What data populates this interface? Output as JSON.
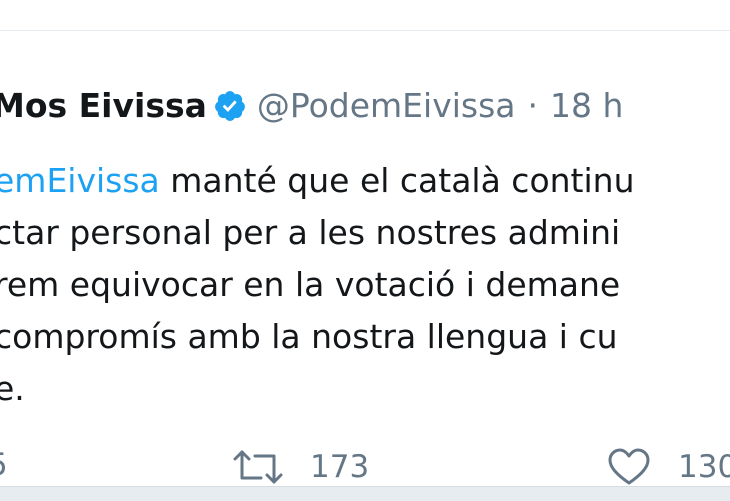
{
  "tweet": {
    "author_name": "Mos Eivissa",
    "verified": true,
    "handle": "@PodemEivissa",
    "separator": "·",
    "time": "18 h",
    "body_lines": [
      {
        "mention": "emEivissa",
        "text": " manté que el català continu"
      },
      {
        "mention": "",
        "text": "ctar personal per a les nostres admini"
      },
      {
        "mention": "",
        "text": "rem equivocar en la votació i demane"
      },
      {
        "mention": "",
        "text": "compromís amb la nostra llengua i cu"
      },
      {
        "mention": "",
        "text": "e."
      }
    ]
  },
  "actions": {
    "reply_count": "5",
    "retweet_count": "173",
    "like_count": "130"
  },
  "colors": {
    "link": "#1da1f2",
    "secondary_text": "#657786",
    "primary_text": "#14171a",
    "verified_badge": "#1da1f2"
  },
  "icons": {
    "verified": "verified-badge-icon",
    "retweet": "retweet-icon",
    "like": "heart-icon"
  }
}
